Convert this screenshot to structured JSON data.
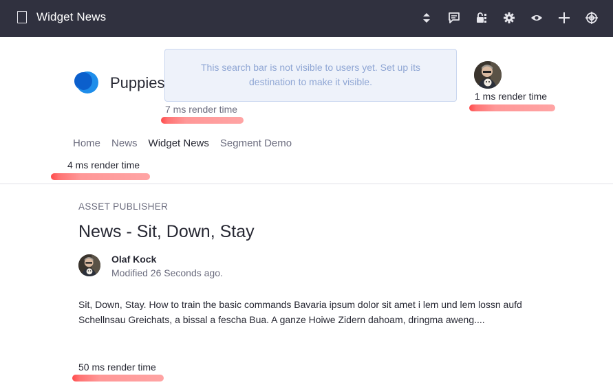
{
  "topbar": {
    "title": "Widget News",
    "tools": [
      {
        "name": "simulation-arrows-icon"
      },
      {
        "name": "comments-icon"
      },
      {
        "name": "permissions-lock-icon"
      },
      {
        "name": "configuration-gear-icon"
      },
      {
        "name": "preview-eye-icon"
      },
      {
        "name": "add-plus-icon"
      },
      {
        "name": "target-icon"
      }
    ]
  },
  "header": {
    "site_name": "Puppies",
    "search_notice": "This search bar is not visible to users yet. Set up its destination to make it visible.",
    "search_render_time": "7 ms render time",
    "user_render_time": "1 ms render time"
  },
  "nav": {
    "items": [
      {
        "label": "Home",
        "active": false
      },
      {
        "label": "News",
        "active": false
      },
      {
        "label": "Widget News",
        "active": true
      },
      {
        "label": "Segment Demo",
        "active": false
      }
    ],
    "render_time": "4 ms render time"
  },
  "asset_publisher": {
    "portlet_title": "ASSET PUBLISHER",
    "article_title": "News - Sit, Down, Stay",
    "author": "Olaf Kock",
    "modified": "Modified 26 Seconds ago.",
    "summary": "Sit, Down, Stay. How to train the basic commands Bavaria ipsum dolor sit amet i lem und lem lossn aufd Schellnsau Greichats, a bissal a fescha Bua. A ganze Hoiwe Zidern dahoam, dringma aweng....",
    "render_time": "50 ms render time"
  },
  "colors": {
    "topbar": "#30313f",
    "streak": "#ff5a5a",
    "notice_bg": "#eef2fa",
    "notice_text": "#8fa6d4"
  }
}
